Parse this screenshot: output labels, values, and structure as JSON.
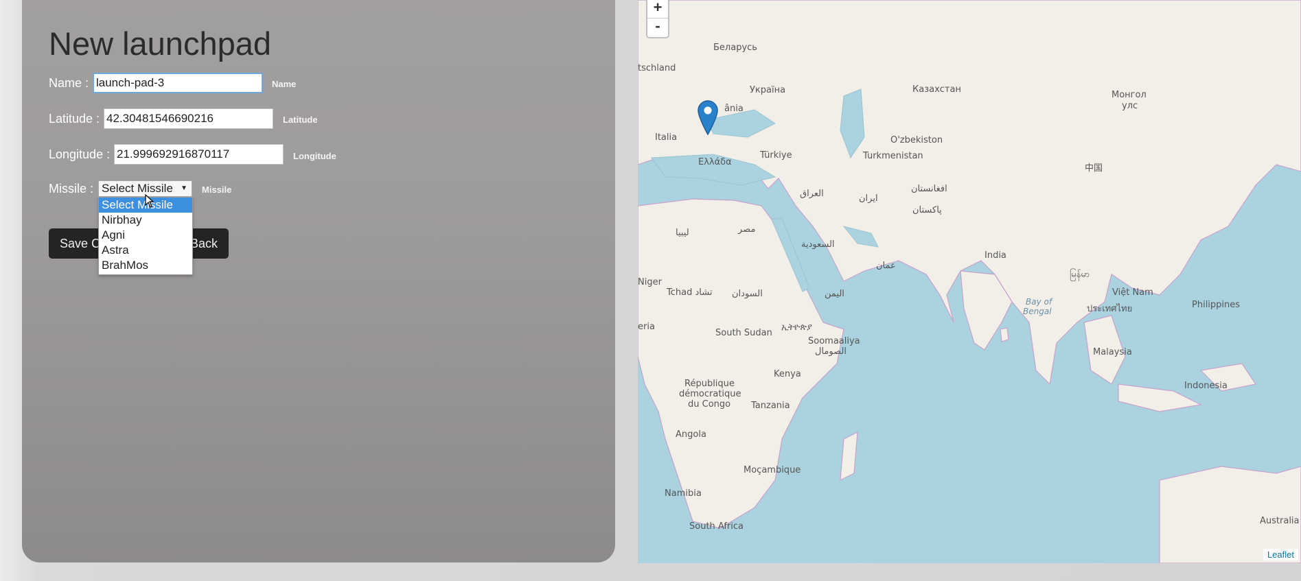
{
  "form": {
    "title": "New launchpad",
    "name": {
      "label": "Name :",
      "value": "launch-pad-3",
      "hint": "Name"
    },
    "latitude": {
      "label": "Latitude :",
      "value": "42.30481546690216",
      "hint": "Latitude"
    },
    "longitude": {
      "label": "Longitude :",
      "value": "21.999692916870117",
      "hint": "Longitude"
    },
    "missile": {
      "label": "Missile :",
      "selected": "Select Missile",
      "hint": "Missile",
      "options": [
        "Select Missile",
        "Nirbhay",
        "Agni",
        "Astra",
        "BrahMos"
      ]
    },
    "buttons": {
      "save": "Save C",
      "back": "Back"
    }
  },
  "map": {
    "zoom_in": "+",
    "zoom_out": "-",
    "attribution": "Leaflet",
    "labels": [
      "Беларусь",
      "tschland",
      "Україна",
      "Казахстан",
      "Монгол",
      "улс",
      "ânia",
      "Italia",
      "Türkiye",
      "Ελλάδα",
      "O'zbekiston",
      "Turkmenistan",
      "中国",
      "العراق",
      "ایران",
      "افغانستان",
      "پاکستان",
      "ليبيا",
      "مصر",
      "السعودية",
      "عمان",
      "India",
      "Niger",
      "Tchad تشاد",
      "السودان",
      "اليمن",
      "Bay of",
      "Bengal",
      "မြန်မာ",
      "Việt Nam",
      "ประเทศไทย",
      "Philippines",
      "eria",
      "South Sudan",
      "ኢትዮጵያ",
      "Soomaaliya",
      "الصومال",
      "Malaysia",
      "Kenya",
      "République",
      "démocratique",
      "du Congo",
      "Tanzania",
      "Indonesia",
      "Angola",
      "Moçambique",
      "Namibia",
      "South Africa",
      "Australia"
    ],
    "colors": {
      "water": "#aad3df",
      "land": "#f2efe9",
      "border": "#c7a2cc",
      "marker": "#2a81cb"
    }
  }
}
